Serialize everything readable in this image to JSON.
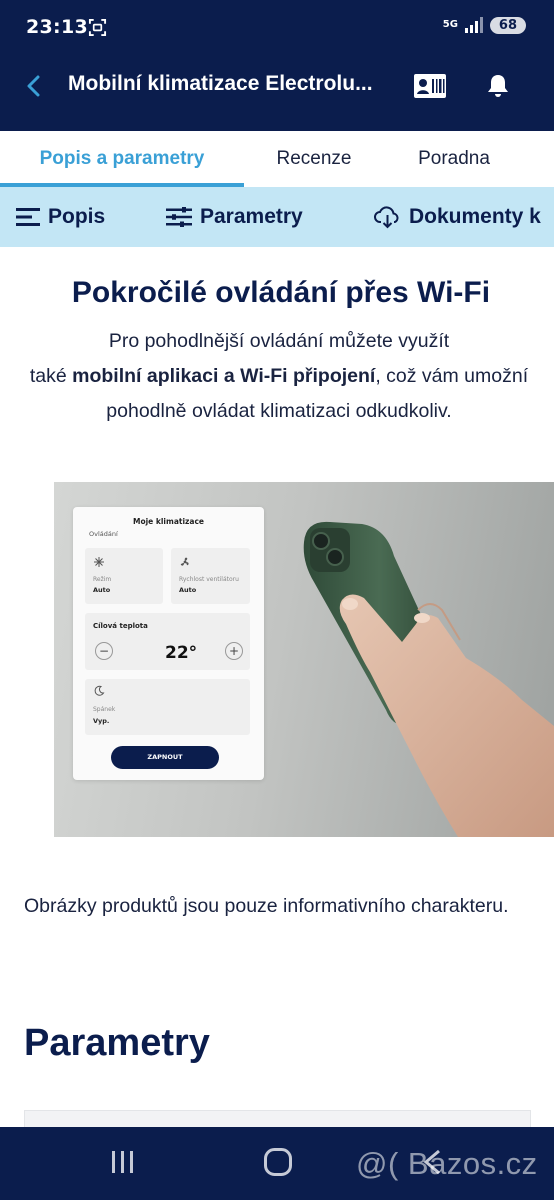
{
  "status_bar": {
    "time": "23:13",
    "network": "5G",
    "battery": "68",
    "icons": [
      "screenshot-icon",
      "signal-icon"
    ]
  },
  "toolbar": {
    "title": "Mobilní klimatizace Electrolu...",
    "icons": [
      "back-arrow-icon",
      "contact-card-icon",
      "bell-icon"
    ]
  },
  "tabs": [
    {
      "label": "Popis a parametry",
      "active": true
    },
    {
      "label": "Recenze",
      "active": false
    },
    {
      "label": "Poradna",
      "active": false
    }
  ],
  "subnav": [
    {
      "label": "Popis",
      "icon": "menu-lines-icon"
    },
    {
      "label": "Parametry",
      "icon": "sliders-icon"
    },
    {
      "label": "Dokumenty k",
      "icon": "cloud-download-icon"
    }
  ],
  "content": {
    "heading": "Pokročilé ovládání přes Wi-Fi",
    "para_line1": "Pro pohodlnější ovládání můžete využít",
    "para_pre": "také ",
    "para_bold": "mobilní aplikaci a Wi-Fi připojení",
    "para_post": ", což vám umožní pohodlně ovládat klimatizaci odkudkoliv.",
    "image": {
      "app_title": "Moje klimatizace",
      "section": "Ovládání",
      "mode_label": "Režim",
      "mode_value": "Auto",
      "fan_label": "Rychlost ventilátoru",
      "fan_value": "Auto",
      "target_label": "Cílová teplota",
      "target_value": "22°",
      "minus": "−",
      "plus": "+",
      "sleep_label": "Spánek",
      "sleep_value": "Vyp.",
      "button": "ZAPNOUT"
    },
    "note": "Obrázky produktů jsou pouze informativního charakteru.",
    "params_heading": "Parametry"
  },
  "nav_bar": {
    "watermark": "@( Bazos.cz",
    "icons": [
      "recent-apps-icon",
      "home-icon",
      "back-nav-icon"
    ]
  },
  "colors": {
    "navy": "#0b1d4d",
    "accent_blue": "#3aa0d6",
    "subnav_bg": "#c3e6f5"
  }
}
